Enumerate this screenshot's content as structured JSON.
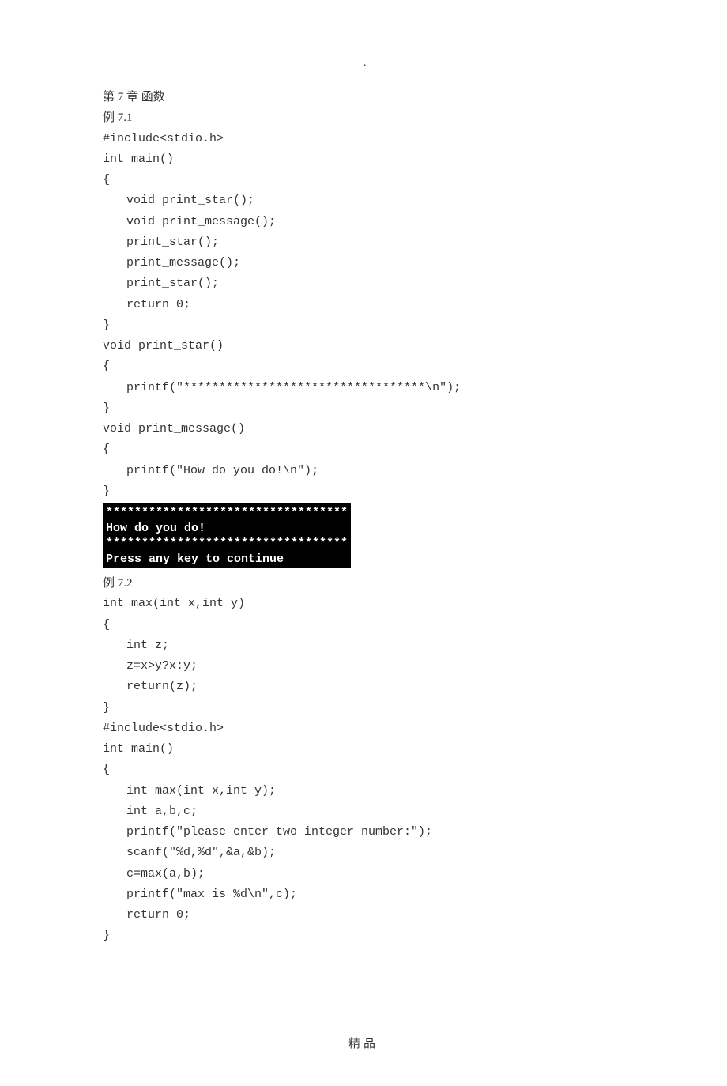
{
  "top_dot": ".",
  "section": {
    "chapter": "第 7 章 函数",
    "ex71_label": "例 7.1",
    "ex72_label": "例 7.2"
  },
  "code71": {
    "l1": "#include<stdio.h>",
    "l2": "int main()",
    "l3": "{",
    "l4": "void print_star();",
    "l5": "void print_message();",
    "l6": "print_star();",
    "l7": "print_message();",
    "l8": "print_star();",
    "l9": "return 0;",
    "l10": "}",
    "l11": "void print_star()",
    "l12": "{",
    "l13": "printf(\"**********************************\\n\");",
    "l14": "}",
    "l15": "void print_message()",
    "l16": "{",
    "l17": "printf(\"How do you do!\\n\");",
    "l18": "}"
  },
  "console": {
    "l1": "**********************************",
    "l2": "How do you do!",
    "l3": "**********************************",
    "l4": "Press any key to continue"
  },
  "code72": {
    "l1": "int max(int x,int y)",
    "l2": "{",
    "l3": "int z;",
    "l4": "z=x>y?x:y;",
    "l5": "return(z);",
    "l6": "}",
    "l7": "#include<stdio.h>",
    "l8": "int main()",
    "l9": "{",
    "l10": "int max(int x,int y);",
    "l11": "int a,b,c;",
    "l12": "printf(\"please enter two integer number:\");",
    "l13": "scanf(\"%d,%d\",&a,&b);",
    "l14": "c=max(a,b);",
    "l15": "printf(\"max is %d\\n\",c);",
    "l16": "return 0;",
    "l17": "}"
  },
  "footer": "精品"
}
